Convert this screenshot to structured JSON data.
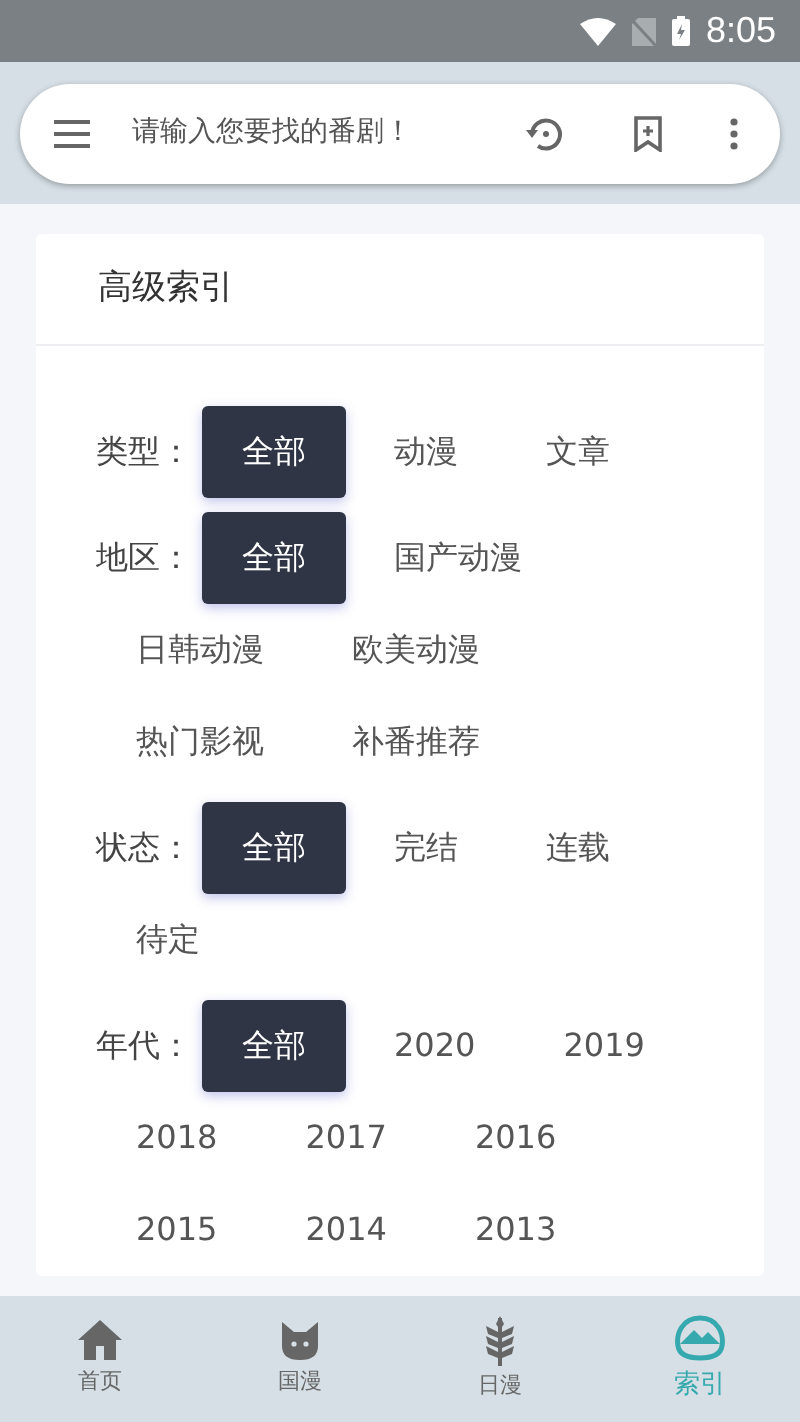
{
  "status_bar": {
    "time": "8:05"
  },
  "search": {
    "placeholder": "请输入您要找的番剧！"
  },
  "card": {
    "title": "高级索引",
    "filters": [
      {
        "label": "类型：",
        "options": [
          {
            "text": "全部",
            "selected": true
          },
          {
            "text": "动漫",
            "selected": false
          },
          {
            "text": "文章",
            "selected": false
          }
        ]
      },
      {
        "label": "地区：",
        "options": [
          {
            "text": "全部",
            "selected": true
          },
          {
            "text": "国产动漫",
            "selected": false
          },
          {
            "text": "日韩动漫",
            "selected": false
          },
          {
            "text": "欧美动漫",
            "selected": false
          },
          {
            "text": "热门影视",
            "selected": false
          },
          {
            "text": "补番推荐",
            "selected": false
          }
        ]
      },
      {
        "label": "状态：",
        "options": [
          {
            "text": "全部",
            "selected": true
          },
          {
            "text": "完结",
            "selected": false
          },
          {
            "text": "连载",
            "selected": false
          },
          {
            "text": "待定",
            "selected": false
          }
        ]
      },
      {
        "label": "年代：",
        "options": [
          {
            "text": "全部",
            "selected": true
          },
          {
            "text": "2020",
            "selected": false
          },
          {
            "text": "2019",
            "selected": false
          },
          {
            "text": "2018",
            "selected": false
          },
          {
            "text": "2017",
            "selected": false
          },
          {
            "text": "2016",
            "selected": false
          },
          {
            "text": "2015",
            "selected": false
          },
          {
            "text": "2014",
            "selected": false
          },
          {
            "text": "2013",
            "selected": false
          }
        ]
      }
    ]
  },
  "bottom_nav": [
    {
      "label": "首页",
      "kind": "home",
      "selected": false
    },
    {
      "label": "国漫",
      "kind": "cat",
      "selected": false
    },
    {
      "label": "日漫",
      "kind": "wheat",
      "selected": false
    },
    {
      "label": "索引",
      "kind": "mountain",
      "selected": true
    }
  ]
}
